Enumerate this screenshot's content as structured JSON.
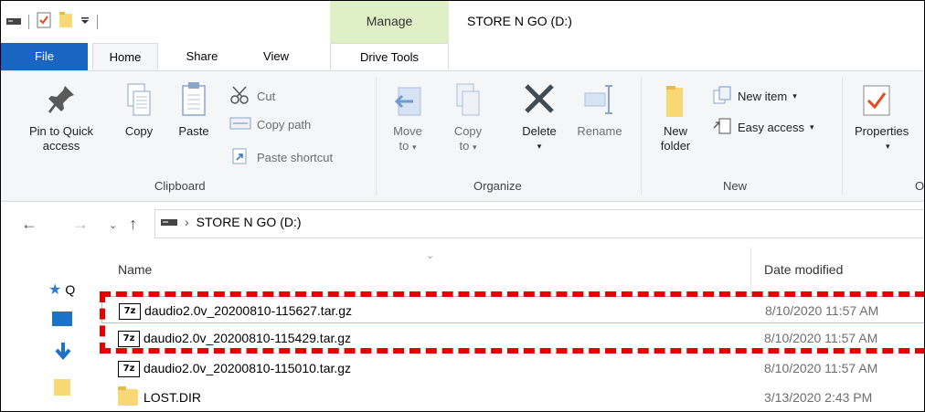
{
  "window": {
    "title": "STORE N GO (D:)",
    "contextual_tab_group": "Manage"
  },
  "tabs": {
    "file": "File",
    "home": "Home",
    "share": "Share",
    "view": "View",
    "drive_tools": "Drive Tools"
  },
  "ribbon": {
    "clipboard": {
      "pin": "Pin to Quick access",
      "pin_line1": "Pin to Quick",
      "pin_line2": "access",
      "copy": "Copy",
      "paste": "Paste",
      "cut": "Cut",
      "copy_path": "Copy path",
      "paste_shortcut": "Paste shortcut",
      "group_label": "Clipboard"
    },
    "organize": {
      "move_line1": "Move",
      "move_line2": "to",
      "copy_line1": "Copy",
      "copy_line2": "to",
      "delete": "Delete",
      "rename": "Rename",
      "group_label": "Organize"
    },
    "new": {
      "new_folder_line1": "New",
      "new_folder_line2": "folder",
      "new_item": "New item",
      "easy_access": "Easy access",
      "group_label": "New"
    },
    "open": {
      "properties": "Properties",
      "group_label_partial": "O"
    }
  },
  "address": {
    "path": "STORE N GO (D:)"
  },
  "navpane": {
    "quick_access_partial": "Q"
  },
  "columns": {
    "name": "Name",
    "date_modified": "Date modified"
  },
  "files": [
    {
      "name": "daudio2.0v_20200810-115627.tar.gz",
      "date": "8/10/2020 11:57 AM",
      "icon": "7z-archive-icon"
    },
    {
      "name": "daudio2.0v_20200810-115429.tar.gz",
      "date": "8/10/2020 11:57 AM",
      "icon": "7z-archive-icon"
    },
    {
      "name": "daudio2.0v_20200810-115010.tar.gz",
      "date": "8/10/2020 11:57 AM",
      "icon": "7z-archive-icon"
    },
    {
      "name": "LOST.DIR",
      "date": "3/13/2020 2:43 PM",
      "icon": "folder-icon"
    }
  ],
  "archive_icon_text": "7z",
  "annotation_color": "#e60000"
}
